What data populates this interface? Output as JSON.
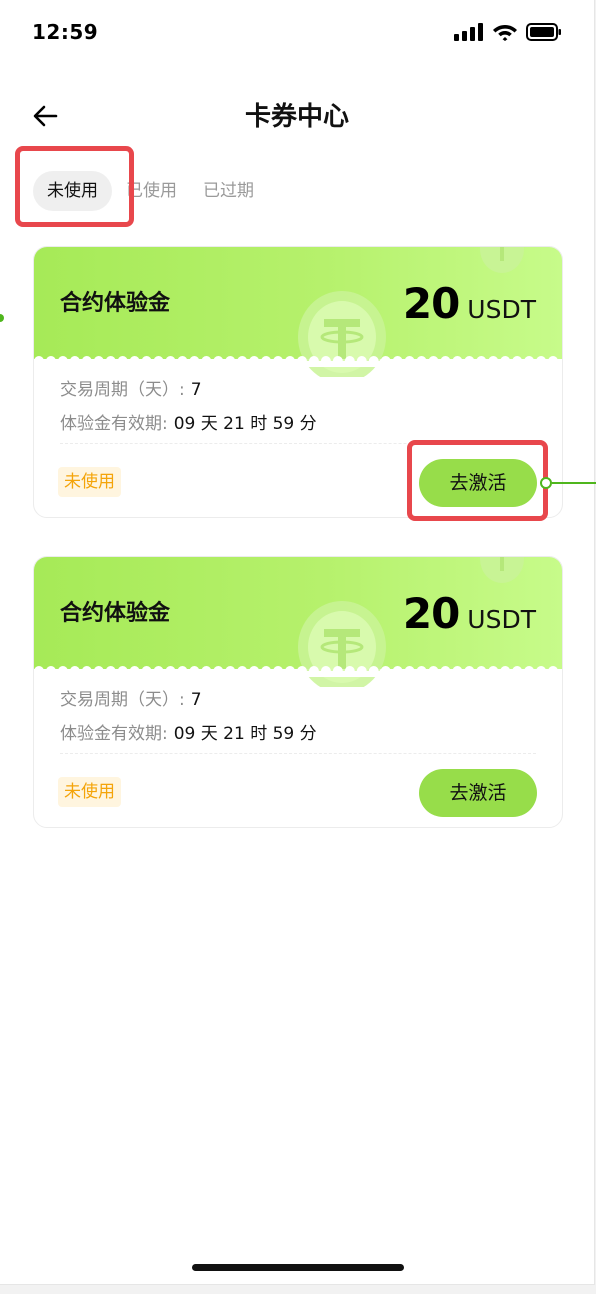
{
  "status_bar": {
    "time": "12:59",
    "icons": [
      "signal-icon",
      "wifi-icon",
      "battery-icon"
    ]
  },
  "header": {
    "title": "卡券中心",
    "back_icon": "arrow-left-icon"
  },
  "tabs": [
    {
      "label": "未使用",
      "active": true
    },
    {
      "label": "已使用",
      "active": false
    },
    {
      "label": "已过期",
      "active": false
    }
  ],
  "coupons": [
    {
      "name": "合约体验金",
      "amount": "20",
      "unit": "USDT",
      "cycle_label": "交易周期（天）:",
      "cycle_value": "7",
      "validity_label": "体验金有效期:",
      "validity_value": "09 天 21 时 59 分",
      "status": "未使用",
      "action": "去激活"
    },
    {
      "name": "合约体验金",
      "amount": "20",
      "unit": "USDT",
      "cycle_label": "交易周期（天）:",
      "cycle_value": "7",
      "validity_label": "体验金有效期:",
      "validity_value": "09 天 21 时 59 分",
      "status": "未使用",
      "action": "去激活"
    }
  ],
  "colors": {
    "accent_green": "#97dd4a",
    "coupon_gradient_start": "#a6ea57",
    "coupon_gradient_end": "#c7fb8a",
    "status_orange": "#f4a40a",
    "annotation_red": "#e8474c",
    "connector_green": "#4fb61d"
  }
}
